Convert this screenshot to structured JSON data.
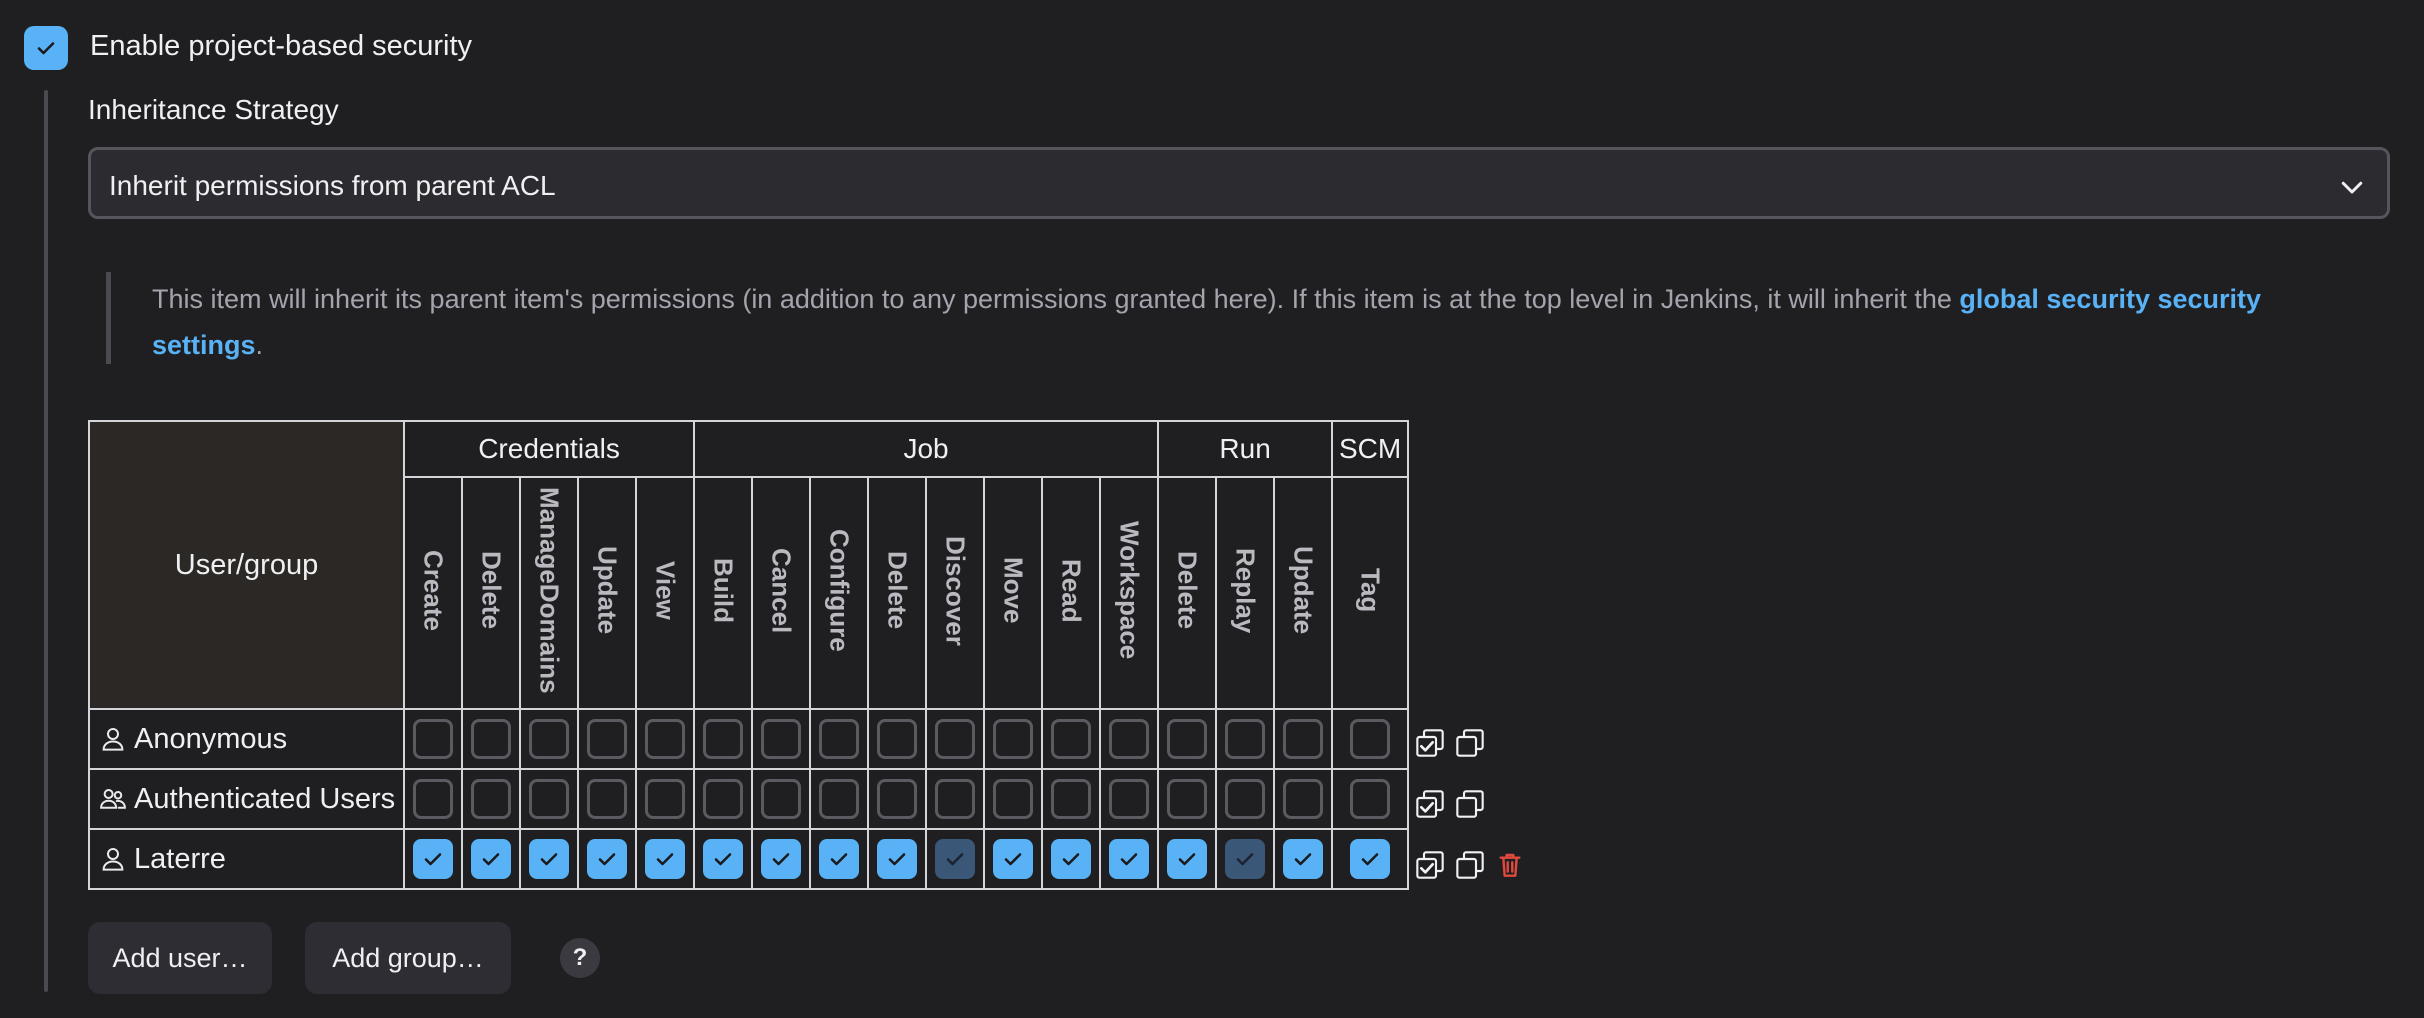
{
  "enable_security": {
    "label": "Enable project-based security",
    "checked": true
  },
  "inheritance": {
    "label": "Inheritance Strategy",
    "selected": "Inherit permissions from parent ACL"
  },
  "description": {
    "text": "This item will inherit its parent item's permissions (in addition to any permissions granted here). If this item is at the top level in Jenkins, it will inherit the ",
    "link": "global security security settings",
    "suffix": "."
  },
  "matrix": {
    "user_header": "User/group",
    "groups": [
      {
        "name": "Credentials",
        "permissions": [
          "Create",
          "Delete",
          "ManageDomains",
          "Update",
          "View"
        ]
      },
      {
        "name": "Job",
        "permissions": [
          "Build",
          "Cancel",
          "Configure",
          "Delete",
          "Discover",
          "Move",
          "Read",
          "Workspace"
        ]
      },
      {
        "name": "Run",
        "permissions": [
          "Delete",
          "Replay",
          "Update"
        ]
      },
      {
        "name": "SCM",
        "permissions": [
          "Tag"
        ]
      }
    ],
    "rows": [
      {
        "name": "Anonymous",
        "icon": "person-icon",
        "deletable": false,
        "states": [
          "off",
          "off",
          "off",
          "off",
          "off",
          "off",
          "off",
          "off",
          "off",
          "off",
          "off",
          "off",
          "off",
          "off",
          "off",
          "off",
          "off"
        ]
      },
      {
        "name": "Authenticated Users",
        "icon": "group-icon",
        "deletable": false,
        "states": [
          "off",
          "off",
          "off",
          "off",
          "off",
          "off",
          "off",
          "off",
          "off",
          "off",
          "off",
          "off",
          "off",
          "off",
          "off",
          "off",
          "off"
        ]
      },
      {
        "name": "Laterre",
        "icon": "person-icon",
        "deletable": true,
        "states": [
          "on",
          "on",
          "on",
          "on",
          "on",
          "on",
          "on",
          "on",
          "on",
          "inherited",
          "on",
          "on",
          "on",
          "on",
          "inherited",
          "on",
          "on"
        ]
      }
    ]
  },
  "buttons": {
    "add_user": "Add user…",
    "add_group": "Add group…",
    "help": "?"
  },
  "colors": {
    "accent": "#59b2f5",
    "inherited": "#3a5777",
    "danger": "#e0493e",
    "background": "#1f1f22"
  }
}
